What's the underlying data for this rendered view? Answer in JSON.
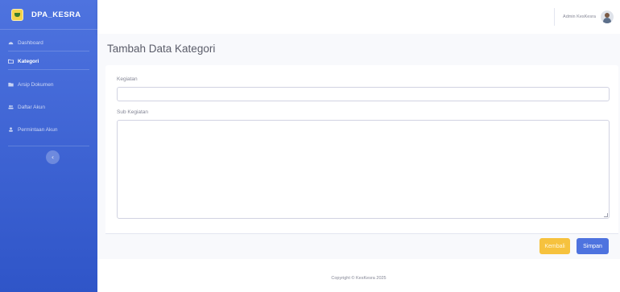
{
  "sidebar": {
    "brand": "DPA_KESRA",
    "items": [
      {
        "label": "Dashboard",
        "icon": "dashboard-icon",
        "active": false
      },
      {
        "label": "Kategori",
        "icon": "folder-icon",
        "active": true
      },
      {
        "label": "Arsip Dokumen",
        "icon": "archive-icon",
        "active": false
      },
      {
        "label": "Daftar Akun",
        "icon": "users-icon",
        "active": false
      },
      {
        "label": "Permintaan Akun",
        "icon": "user-icon",
        "active": false
      }
    ],
    "toggle_icon": "‹"
  },
  "topbar": {
    "user_name": "Admin KesKesra"
  },
  "page": {
    "title": "Tambah Data Kategori"
  },
  "form": {
    "kegiatan_label": "Kegiatan",
    "kegiatan_value": "",
    "sub_kegiatan_label": "Sub Kegiatan",
    "sub_kegiatan_value": ""
  },
  "buttons": {
    "back": "Kembali",
    "save": "Simpan"
  },
  "footer": {
    "copyright": "Copyright © KesKesra 2025"
  },
  "colors": {
    "sidebar": "#4e73df",
    "primary": "#4e73df",
    "warning": "#f6c23e"
  }
}
